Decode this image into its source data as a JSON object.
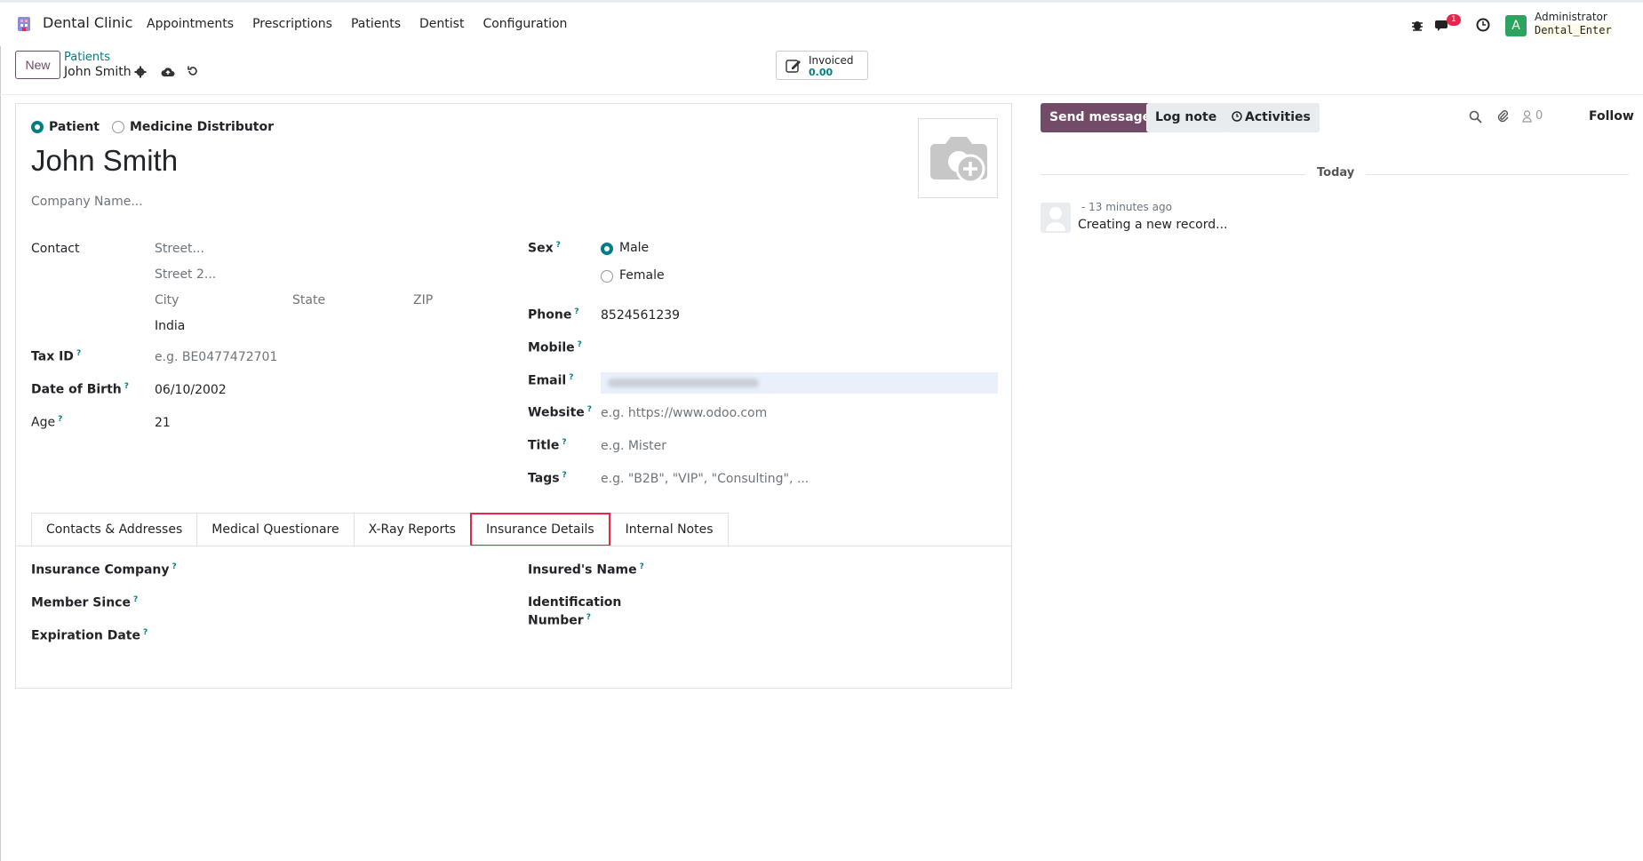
{
  "navbar": {
    "brand": "Dental Clinic",
    "menu": [
      "Appointments",
      "Prescriptions",
      "Patients",
      "Dentist",
      "Configuration"
    ],
    "notification_count": "1",
    "avatar_letter": "A",
    "user": "Administrator",
    "database": "Dental_Enter"
  },
  "control_panel": {
    "new_label": "New",
    "breadcrumb_parent": "Patients",
    "breadcrumb_current": "John Smith",
    "stat_label": "Invoiced",
    "stat_value": "0.00"
  },
  "form": {
    "type_options": [
      "Patient",
      "Medicine Distributor"
    ],
    "type_selected": "Patient",
    "name": "John Smith",
    "company_placeholder": "Company Name...",
    "labels": {
      "contact": "Contact",
      "tax_id": "Tax ID",
      "dob": "Date of Birth",
      "age": "Age",
      "sex": "Sex",
      "phone": "Phone",
      "mobile": "Mobile",
      "email": "Email",
      "website": "Website",
      "title": "Title",
      "tags": "Tags"
    },
    "placeholders": {
      "street": "Street...",
      "street2": "Street 2...",
      "city": "City",
      "state": "State",
      "zip": "ZIP",
      "tax_id": "e.g. BE0477472701",
      "website": "e.g. https://www.odoo.com",
      "title": "e.g. Mister",
      "tags": "e.g. \"B2B\", \"VIP\", \"Consulting\", ..."
    },
    "values": {
      "country": "India",
      "dob": "06/10/2002",
      "age": "21",
      "phone": "8524561239"
    },
    "sex_options": [
      "Male",
      "Female"
    ],
    "sex_selected": "Male",
    "help_marker": "?"
  },
  "tabs": [
    "Contacts & Addresses",
    "Medical Questionare",
    "X-Ray Reports",
    "Insurance Details",
    "Internal Notes"
  ],
  "active_tab": "Insurance Details",
  "insurance": {
    "insurance_company": "Insurance Company",
    "member_since": "Member Since",
    "expiration_date": "Expiration Date",
    "insured_name": "Insured's Name",
    "identification_1": "Identification",
    "identification_2": "Number"
  },
  "chatter": {
    "send_message": "Send message",
    "log_note": "Log note",
    "activities": "Activities",
    "follower_count": "0",
    "follow": "Follow",
    "date_separator": "Today",
    "message_time": "- 13 minutes ago",
    "message_body": "Creating a new record..."
  },
  "colors": {
    "primary": "#714b67",
    "accent": "#017e84",
    "highlight": "#e8254a"
  }
}
